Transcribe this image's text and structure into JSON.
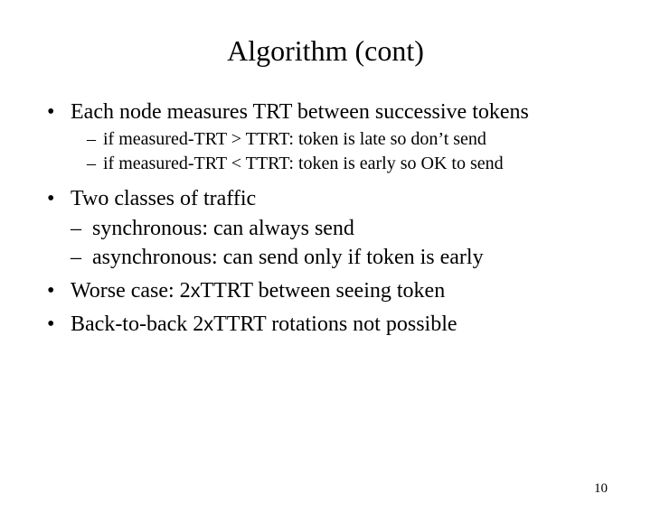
{
  "title": "Algorithm (cont)",
  "bullets": {
    "b1": "Each node measures TRT between successive tokens",
    "b1_sub": {
      "s1": "if measured-TRT > TTRT: token is late so don’t send",
      "s2": "if measured-TRT < TTRT: token is early so OK to send"
    },
    "b2": "Two classes of traffic",
    "b2_sub": {
      "s1": "synchronous: can always send",
      "s2": "asynchronous: can send only if token is early"
    },
    "b3_pre": "Worse case: 2",
    "b3_x": "x",
    "b3_post": "TTRT between seeing token",
    "b4_pre": "Back-to-back 2",
    "b4_x": "x",
    "b4_post": "TTRT rotations not possible"
  },
  "page_number": "10"
}
